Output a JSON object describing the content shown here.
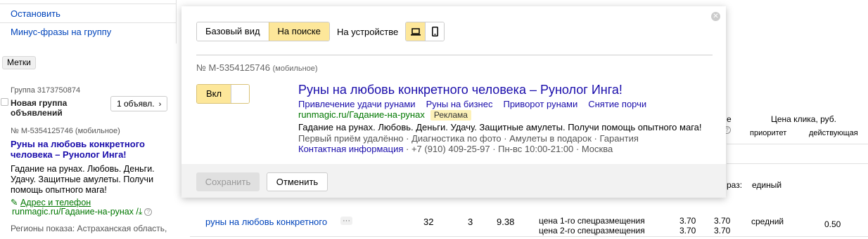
{
  "left_menu": {
    "items": [
      "Остановить",
      "Минус-фразы на группу"
    ]
  },
  "tags_button": "Метки",
  "group": {
    "id_text": "Группа 3173750874",
    "name": "Новая группа объявлений",
    "ads_count": "1 объявл."
  },
  "mini_ad": {
    "number": "№ M-5354125746 (мобильное)",
    "title": "Руны на любовь конкретного человека – Рунолог Инга!",
    "text": "Гадание на рунах. Любовь. Деньги. Удачу. Защитные амулеты. Получи помощь опытного мага!",
    "contacts": "Адрес и телефон",
    "url": "runmagic.ru/Гадание-на-рунах /",
    "regions": "Регионы показа: Астраханская область,"
  },
  "table": {
    "header_e": "е",
    "price_header": "Цена клика, руб.",
    "priority_header": "приоритет",
    "active_header": "действующая",
    "strategy_label": "раз:",
    "strategy_value": "единый",
    "row": {
      "keyword": "руны на любовь конкретного",
      "dots": "···",
      "n1": "32",
      "n2": "3",
      "n3": "9.38",
      "pos1": "цена 1-го спецразмещения",
      "pos2": "цена 2-го спецразмещения",
      "p1a": "3.70",
      "p1b": "3.70",
      "p2a": "3.70",
      "p2b": "3.70",
      "priority": "средний",
      "bid": "0.50"
    }
  },
  "modal": {
    "view_tabs": [
      "Базовый вид",
      "На поиске"
    ],
    "active_view": "На поиске",
    "device_label": "На устройстве",
    "active_device": "desktop",
    "ad_number": "№ M-5354125746",
    "ad_number_suffix": "(мобильное)",
    "toggle_label": "Вкл",
    "preview": {
      "title": "Руны на любовь конкретного человека – Рунолог Инга!",
      "sitelinks": [
        "Привлечение удачи рунами",
        "Руны на бизнес",
        "Приворот рунами",
        "Снятие порчи"
      ],
      "url": "runmagic.ru/Гадание-на-рунах",
      "badge": "Реклама",
      "text": "Гадание на рунах. Любовь. Деньги. Удачу. Защитные амулеты. Получи помощь опытного мага!",
      "extras": "Первый приём удалённо · Диагностика по фото · Амулеты в подарок · Гарантия",
      "contacts_link": "Контактная информация",
      "contacts_rest": " · +7 (910) 409-25-97 · Пн-вс 10:00-21:00 · Москва"
    },
    "save_label": "Сохранить",
    "cancel_label": "Отменить"
  },
  "colors": {
    "accent_yellow": "#fde79a",
    "link_blue": "#1a0dab",
    "url_green": "#007700"
  }
}
